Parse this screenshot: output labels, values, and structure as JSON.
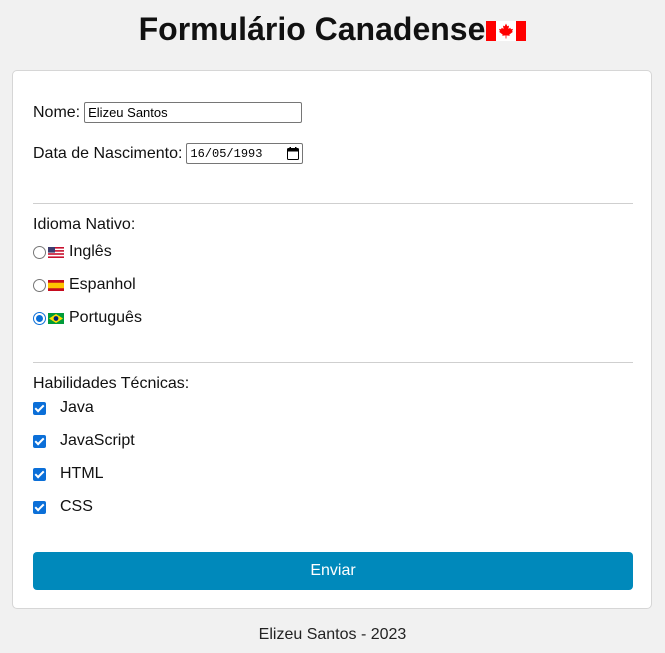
{
  "header": {
    "title": "Formulário Canadense",
    "flag_icon": "canada-flag-icon"
  },
  "form": {
    "name_label": "Nome:",
    "name_value": "Elizeu Santos",
    "dob_label": "Data de Nascimento:",
    "dob_value": "16/05/1993",
    "language_label": "Idioma Nativo:",
    "languages": [
      {
        "label": "Inglês",
        "flag": "us-flag-icon",
        "selected": false
      },
      {
        "label": "Espanhol",
        "flag": "spain-flag-icon",
        "selected": false
      },
      {
        "label": "Português",
        "flag": "brazil-flag-icon",
        "selected": true
      }
    ],
    "skills_label": "Habilidades Técnicas:",
    "skills": [
      {
        "label": "Java",
        "checked": true
      },
      {
        "label": "JavaScript",
        "checked": true
      },
      {
        "label": "HTML",
        "checked": true
      },
      {
        "label": "CSS",
        "checked": true
      }
    ],
    "submit_label": "Enviar"
  },
  "footer": {
    "text": "Elizeu Santos - 2023"
  },
  "colors": {
    "accent": "#0089bb",
    "control_blue": "#0b6fd8",
    "background": "#f1f1f1",
    "flag_red": "#ff0000"
  }
}
